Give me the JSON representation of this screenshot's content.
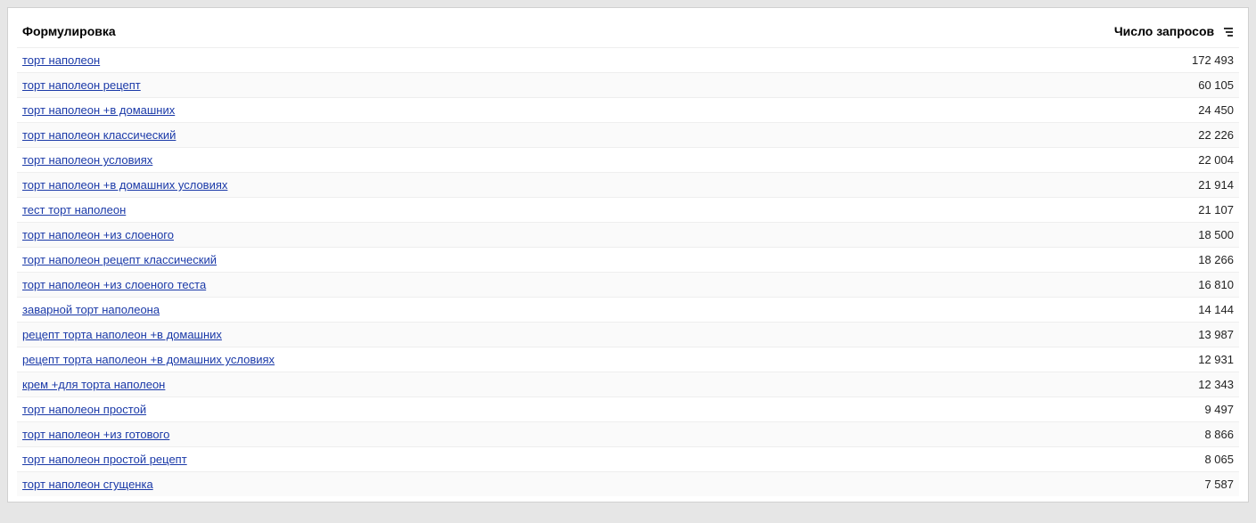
{
  "table": {
    "header_query": "Формулировка",
    "header_count": "Число запросов",
    "sort_icon_name": "sort-desc-icon"
  },
  "rows": [
    {
      "query": "торт наполеон",
      "count": "172 493"
    },
    {
      "query": "торт наполеон рецепт",
      "count": "60 105"
    },
    {
      "query": "торт наполеон +в домашних",
      "count": "24 450"
    },
    {
      "query": "торт наполеон классический",
      "count": "22 226"
    },
    {
      "query": "торт наполеон условиях",
      "count": "22 004"
    },
    {
      "query": "торт наполеон +в домашних условиях",
      "count": "21 914"
    },
    {
      "query": "тест торт наполеон",
      "count": "21 107"
    },
    {
      "query": "торт наполеон +из слоеного",
      "count": "18 500"
    },
    {
      "query": "торт наполеон рецепт классический",
      "count": "18 266"
    },
    {
      "query": "торт наполеон +из слоеного теста",
      "count": "16 810"
    },
    {
      "query": "заварной торт наполеона",
      "count": "14 144"
    },
    {
      "query": "рецепт торта наполеон +в домашних",
      "count": "13 987"
    },
    {
      "query": "рецепт торта наполеон +в домашних условиях",
      "count": "12 931"
    },
    {
      "query": "крем +для торта наполеон",
      "count": "12 343"
    },
    {
      "query": "торт наполеон простой",
      "count": "9 497"
    },
    {
      "query": "торт наполеон +из готового",
      "count": "8 866"
    },
    {
      "query": "торт наполеон простой рецепт",
      "count": "8 065"
    },
    {
      "query": "торт наполеон сгущенка",
      "count": "7 587"
    }
  ]
}
